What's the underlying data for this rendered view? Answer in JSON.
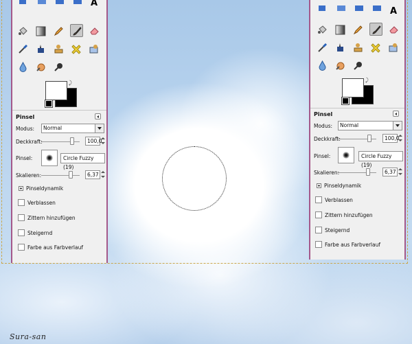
{
  "left_panel": {
    "title": "Pinsel",
    "modus_label": "Modus:",
    "modus_value": "Normal",
    "deckkraft_label": "Deckkraft:",
    "deckkraft_value": "100,0",
    "pinsel_label": "Pinsel:",
    "brush_name": "Circle Fuzzy (19)",
    "skalieren_label": "Skalieren:",
    "skalieren_value": "6,37",
    "dynamics_label": "Pinseldynamik",
    "options": [
      "Verblassen",
      "Zittern hinzufügen",
      "Steigernd",
      "Farbe aus Farbverlauf"
    ]
  },
  "right_panel": {
    "title": "Pinsel",
    "modus_label": "Modus:",
    "modus_value": "Normal",
    "deckkraft_label": "Deckkraft:",
    "deckkraft_value": "100,0",
    "pinsel_label": "Pinsel:",
    "brush_name": "Circle Fuzzy (19)",
    "skalieren_label": "Skalieren:",
    "skalieren_value": "6,37",
    "dynamics_label": "Pinseldynamik",
    "options": [
      "Verblassen",
      "Zittern hinzufügen",
      "Steigernd",
      "Farbe aus Farbverlauf"
    ]
  },
  "tools": [
    "text-icon",
    "bucket-fill-icon",
    "blend-icon",
    "pencil-icon",
    "paintbrush-icon",
    "eraser-icon",
    "airbrush-icon",
    "ink-icon",
    "clone-icon",
    "heal-icon",
    "perspective-clone-icon",
    "blur-icon",
    "smudge-icon",
    "dodge-burn-icon"
  ],
  "colors": {
    "foreground": "#ffffff",
    "background": "#000000",
    "panel_border": "#a4588a",
    "selection_outline": "#caa64a"
  },
  "signature": "Sura-san"
}
